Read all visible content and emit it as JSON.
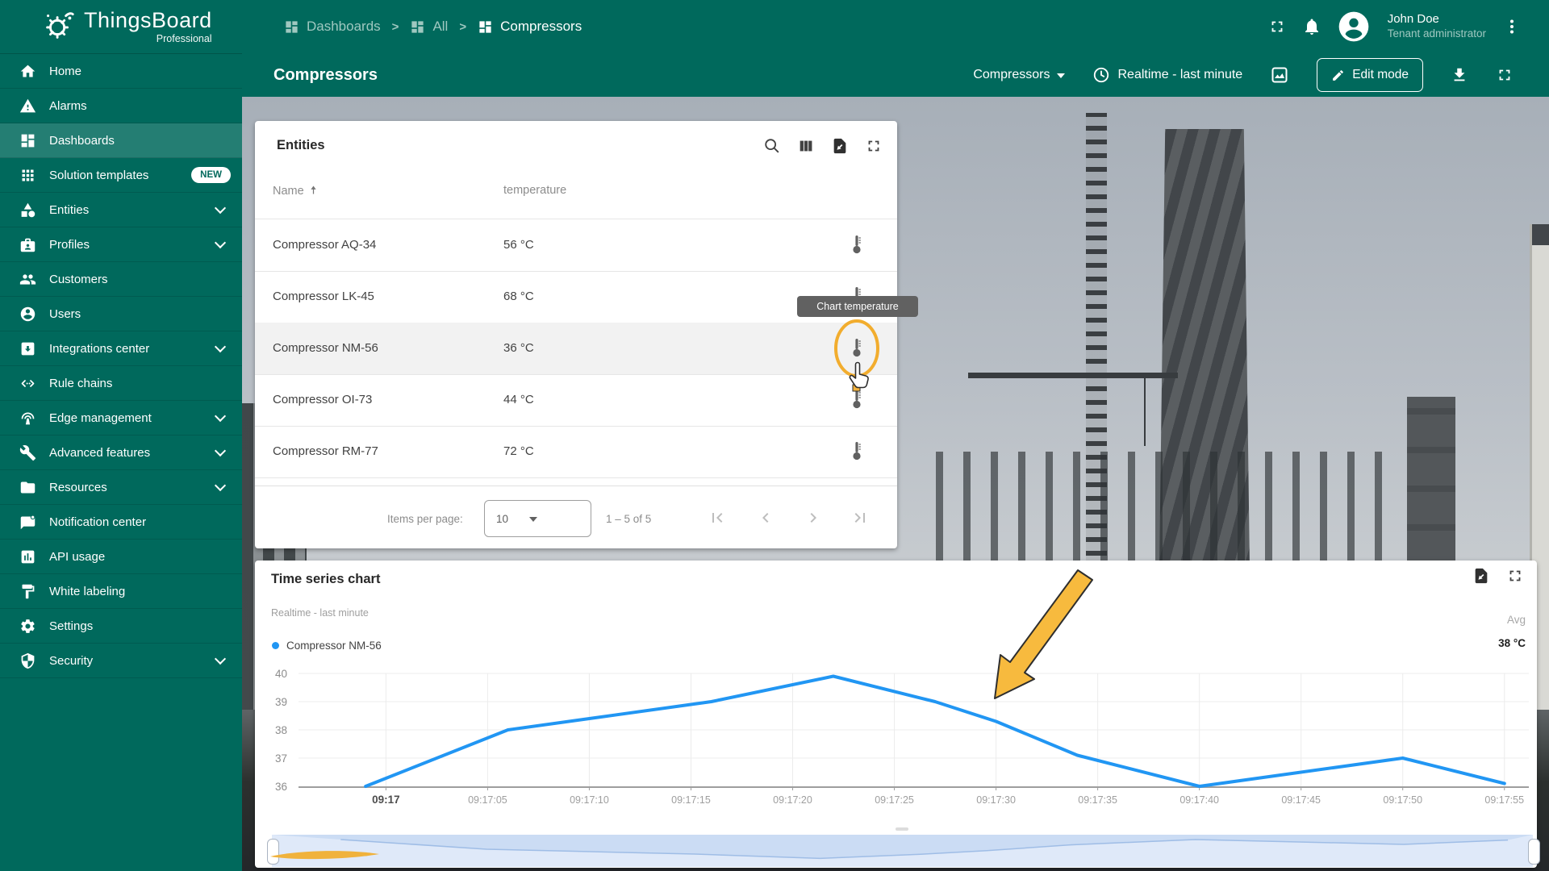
{
  "app": {
    "name": "ThingsBoard",
    "edition": "Professional"
  },
  "breadcrumb": {
    "items": [
      "Dashboards",
      "All",
      "Compressors"
    ]
  },
  "header": {
    "user_name": "John Doe",
    "user_role": "Tenant administrator"
  },
  "toolbar": {
    "title": "Compressors",
    "state_select": "Compressors",
    "time_window": "Realtime - last minute",
    "edit_button": "Edit mode"
  },
  "sidebar": {
    "items": [
      {
        "label": "Home",
        "icon": "home"
      },
      {
        "label": "Alarms",
        "icon": "alarms"
      },
      {
        "label": "Dashboards",
        "icon": "dashboards",
        "active": true
      },
      {
        "label": "Solution templates",
        "icon": "solution-templates",
        "badge": "NEW"
      },
      {
        "label": "Entities",
        "icon": "entities",
        "expandable": true
      },
      {
        "label": "Profiles",
        "icon": "profiles",
        "expandable": true
      },
      {
        "label": "Customers",
        "icon": "customers"
      },
      {
        "label": "Users",
        "icon": "users"
      },
      {
        "label": "Integrations center",
        "icon": "integrations-center",
        "expandable": true
      },
      {
        "label": "Rule chains",
        "icon": "rule-chains"
      },
      {
        "label": "Edge management",
        "icon": "edge-management",
        "expandable": true
      },
      {
        "label": "Advanced features",
        "icon": "advanced-features",
        "expandable": true
      },
      {
        "label": "Resources",
        "icon": "resources",
        "expandable": true
      },
      {
        "label": "Notification center",
        "icon": "notification-center"
      },
      {
        "label": "API usage",
        "icon": "api-usage"
      },
      {
        "label": "White labeling",
        "icon": "white-labeling"
      },
      {
        "label": "Settings",
        "icon": "settings"
      },
      {
        "label": "Security",
        "icon": "security",
        "expandable": true
      }
    ]
  },
  "entities_widget": {
    "title": "Entities",
    "columns": [
      "Name",
      "temperature"
    ],
    "rows": [
      {
        "name": "Compressor AQ-34",
        "temperature": "56 °C"
      },
      {
        "name": "Compressor LK-45",
        "temperature": "68 °C"
      },
      {
        "name": "Compressor NM-56",
        "temperature": "36 °C"
      },
      {
        "name": "Compressor OI-73",
        "temperature": "44 °C"
      },
      {
        "name": "Compressor RM-77",
        "temperature": "72 °C"
      }
    ],
    "selected_row": "Compressor NM-56",
    "tooltip": "Chart temperature",
    "pagination": {
      "items_per_page_label": "Items per page:",
      "page_size": "10",
      "range_label": "1 – 5 of 5"
    }
  },
  "chart_widget": {
    "title": "Time series chart",
    "subtitle": "Realtime - last minute",
    "legend": "Compressor NM-56",
    "agg_label": "Avg",
    "agg_value": "38 °C"
  },
  "chart_data": {
    "type": "line",
    "title": "Time series chart",
    "xlabel": "",
    "ylabel": "",
    "grid": true,
    "legend_position": "top-left",
    "ylim": [
      36,
      40
    ],
    "xlim_s": [
      -4.3,
      56.2
    ],
    "y_ticks": [
      36,
      37,
      38,
      39,
      40
    ],
    "x_ticks": [
      {
        "t": 0,
        "label": "09:17"
      },
      {
        "t": 5,
        "label": "09:17:05"
      },
      {
        "t": 10,
        "label": "09:17:10"
      },
      {
        "t": 15,
        "label": "09:17:15"
      },
      {
        "t": 20,
        "label": "09:17:20"
      },
      {
        "t": 25,
        "label": "09:17:25"
      },
      {
        "t": 30,
        "label": "09:17:30"
      },
      {
        "t": 35,
        "label": "09:17:35"
      },
      {
        "t": 40,
        "label": "09:17:40"
      },
      {
        "t": 45,
        "label": "09:17:45"
      },
      {
        "t": 50,
        "label": "09:17:50"
      },
      {
        "t": 55,
        "label": "09:17:55"
      }
    ],
    "series": [
      {
        "name": "Compressor NM-56",
        "color": "#2196f3",
        "avg": "38 °C",
        "points": [
          [
            -1,
            36.0
          ],
          [
            6,
            38.0
          ],
          [
            10,
            38.4
          ],
          [
            16,
            39.0
          ],
          [
            22,
            39.9
          ],
          [
            27,
            39.0
          ],
          [
            30,
            38.3
          ],
          [
            34,
            37.1
          ],
          [
            40,
            36.0
          ],
          [
            50,
            37.0
          ],
          [
            55,
            36.1
          ]
        ]
      }
    ]
  },
  "colors": {
    "primary": "#00695c",
    "series_blue": "#2196f3",
    "annotation_yellow": "#f2ad2e",
    "tooltip_bg": "#616161",
    "navigator_bg": "#dfe9f9"
  }
}
